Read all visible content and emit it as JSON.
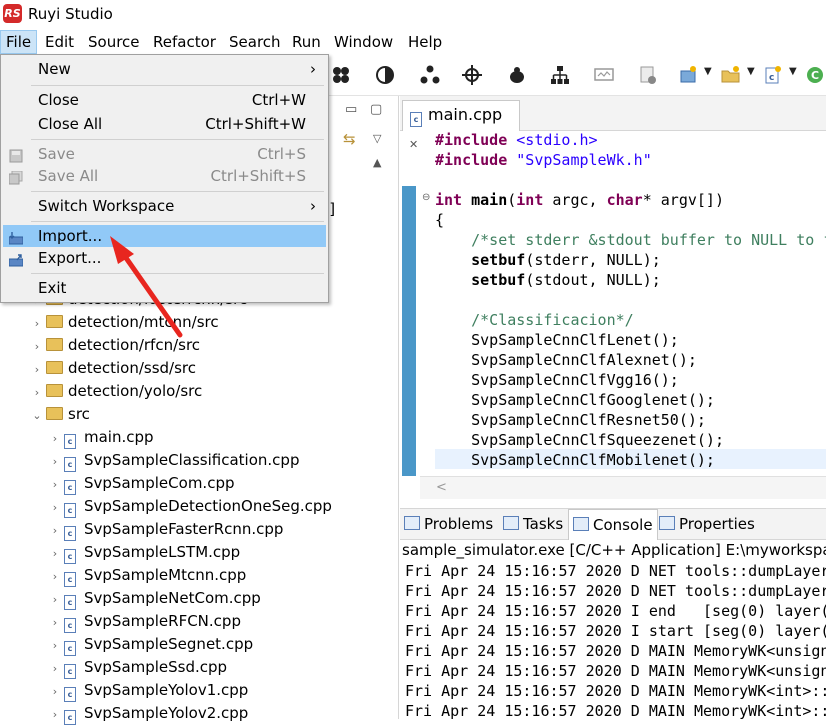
{
  "title_bar": {
    "app_logo_text": "RS",
    "title": "Ruyi Studio"
  },
  "menu_bar": {
    "items": [
      "File",
      "Edit",
      "Source",
      "Refactor",
      "Search",
      "Run",
      "Window",
      "Help"
    ]
  },
  "file_menu": {
    "new": "New",
    "close": "Close",
    "close_shortcut": "Ctrl+W",
    "close_all": "Close All",
    "close_all_shortcut": "Ctrl+Shift+W",
    "save": "Save",
    "save_shortcut": "Ctrl+S",
    "save_all": "Save All",
    "save_all_shortcut": "Ctrl+Shift+S",
    "switch_workspace": "Switch Workspace",
    "import": "Import...",
    "export": "Export...",
    "exit": "Exit",
    "submenu_glyph": "›"
  },
  "explorer": {
    "partial_row": "detection/fasterrcnn/src",
    "folders": [
      "detection/mtcnn/src",
      "detection/rfcn/src",
      "detection/ssd/src",
      "detection/yolo/src",
      "src"
    ],
    "files": [
      "main.cpp",
      "SvpSampleClassification.cpp",
      "SvpSampleCom.cpp",
      "SvpSampleDetectionOneSeg.cpp",
      "SvpSampleFasterRcnn.cpp",
      "SvpSampleLSTM.cpp",
      "SvpSampleMtcnn.cpp",
      "SvpSampleNetCom.cpp",
      "SvpSampleRFCN.cpp",
      "SvpSampleSegnet.cpp",
      "SvpSampleSsd.cpp",
      "SvpSampleYolov1.cpp",
      "SvpSampleYolov2.cpp"
    ],
    "partial_bracket": "e]"
  },
  "editor": {
    "tab_label": "main.cpp",
    "tab_close": "✕",
    "code": {
      "l1_kw": "#include",
      "l1_str": " <stdio.h>",
      "l2_kw": "#include",
      "l2_str": " \"SvpSampleWk.h\"",
      "l3_kw1": "int",
      "l3_fn": " main",
      "l3_a": "(",
      "l3_kw2": "int",
      "l3_b": " argc, ",
      "l3_kw3": "char",
      "l3_c": "* argv[])",
      "l4": "{",
      "l5": "    /*set stderr &stdout buffer to NULL to f",
      "l6_fn": "    setbuf",
      "l6_rest": "(stderr, NULL);",
      "l7_fn": "    setbuf",
      "l7_rest": "(stdout, NULL);",
      "l8": "    /*Classificacion*/",
      "calls": [
        "    SvpSampleCnnClfLenet();",
        "    SvpSampleCnnClfAlexnet();",
        "    SvpSampleCnnClfVgg16();",
        "    SvpSampleCnnClfGooglenet();",
        "    SvpSampleCnnClfResnet50();",
        "    SvpSampleCnnClfSqueezenet();",
        "    SvpSampleCnnClfMobilenet();"
      ]
    },
    "scroll_left_glyph": "<"
  },
  "bottom_panel": {
    "tabs": [
      "Problems",
      "Tasks",
      "Console",
      "Properties"
    ],
    "console_header": "sample_simulator.exe [C/C++ Application] E:\\myworkspace",
    "lines": [
      "Fri Apr 24 15:16:57 2020 D NET tools::dumpLayer",
      "Fri Apr 24 15:16:57 2020 D NET tools::dumpLayer",
      "Fri Apr 24 15:16:57 2020 I end   [seg(0) layer(",
      "Fri Apr 24 15:16:57 2020 I start [seg(0) layer(",
      "Fri Apr 24 15:16:57 2020 D MAIN MemoryWK<unsign",
      "Fri Apr 24 15:16:57 2020 D MAIN MemoryWK<unsign",
      "Fri Apr 24 15:16:57 2020 D MAIN MemoryWK<int>::",
      "Fri Apr 24 15:16:57 2020 D MAIN MemoryWK<int>::"
    ]
  },
  "colors": {
    "accent_selection": "#91c9f7",
    "annotation_arrow": "#e8261f",
    "keyword": "#7f0055",
    "string": "#2a00ff",
    "comment": "#3f7f5f"
  }
}
